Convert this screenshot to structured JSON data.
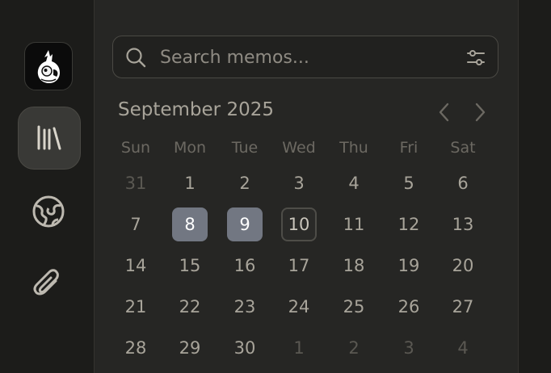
{
  "sidebar": {
    "items": [
      {
        "name": "avatar",
        "icon": "cockatiel-avatar-icon"
      },
      {
        "name": "library",
        "icon": "library-icon",
        "active": true
      },
      {
        "name": "explore",
        "icon": "globe-icon"
      },
      {
        "name": "attachments",
        "icon": "paperclip-icon"
      }
    ]
  },
  "search": {
    "placeholder": "Search memos...",
    "value": "",
    "left_icon": "search-icon",
    "right_icon": "filter-sliders-icon"
  },
  "calendar": {
    "month_title": "September 2025",
    "prev_icon": "chevron-left-icon",
    "next_icon": "chevron-right-icon",
    "weekdays": [
      "Sun",
      "Mon",
      "Tue",
      "Wed",
      "Thu",
      "Fri",
      "Sat"
    ],
    "weeks": [
      [
        {
          "d": "31",
          "m": true
        },
        {
          "d": "1"
        },
        {
          "d": "2"
        },
        {
          "d": "3"
        },
        {
          "d": "4"
        },
        {
          "d": "5"
        },
        {
          "d": "6"
        }
      ],
      [
        {
          "d": "7"
        },
        {
          "d": "8",
          "sel": true
        },
        {
          "d": "9",
          "sel": true
        },
        {
          "d": "10",
          "today": true
        },
        {
          "d": "11"
        },
        {
          "d": "12"
        },
        {
          "d": "13"
        }
      ],
      [
        {
          "d": "14"
        },
        {
          "d": "15"
        },
        {
          "d": "16"
        },
        {
          "d": "17"
        },
        {
          "d": "18"
        },
        {
          "d": "19"
        },
        {
          "d": "20"
        }
      ],
      [
        {
          "d": "21"
        },
        {
          "d": "22"
        },
        {
          "d": "23"
        },
        {
          "d": "24"
        },
        {
          "d": "25"
        },
        {
          "d": "26"
        },
        {
          "d": "27"
        }
      ],
      [
        {
          "d": "28"
        },
        {
          "d": "29"
        },
        {
          "d": "30"
        },
        {
          "d": "1",
          "m": true
        },
        {
          "d": "2",
          "m": true
        },
        {
          "d": "3",
          "m": true
        },
        {
          "d": "4",
          "m": true
        }
      ]
    ]
  },
  "colors": {
    "background": "#1c1c1a",
    "panel": "#262624",
    "selected_day": "#727782",
    "text": "#a8a49a",
    "muted_text": "#5a5852"
  }
}
